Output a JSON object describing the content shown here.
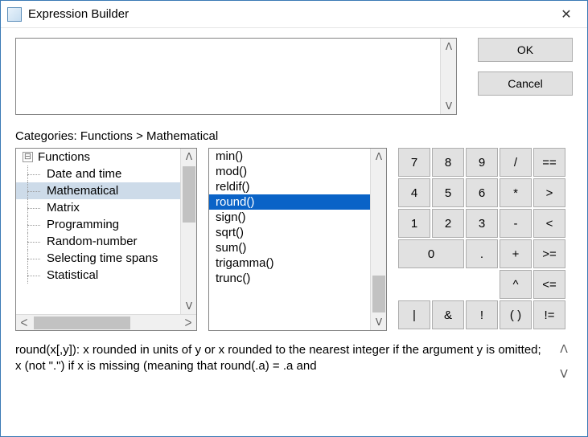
{
  "window": {
    "title": "Expression Builder",
    "close_glyph": "✕"
  },
  "expression": {
    "value": ""
  },
  "buttons": {
    "ok": "OK",
    "cancel": "Cancel"
  },
  "breadcrumb": "Categories: Functions > Mathematical",
  "tree": {
    "root": "Functions",
    "items": [
      "Date and time",
      "Mathematical",
      "Matrix",
      "Programming",
      "Random-number",
      "Selecting time spans",
      "Statistical"
    ],
    "selected_index": 1
  },
  "functions": {
    "items": [
      "min()",
      "mod()",
      "reldif()",
      "round()",
      "sign()",
      "sqrt()",
      "sum()",
      "trigamma()",
      "trunc()"
    ],
    "selected_index": 3
  },
  "keypad": {
    "rows": [
      [
        "7",
        "8",
        "9",
        "/",
        "=="
      ],
      [
        "4",
        "5",
        "6",
        "*",
        ">"
      ],
      [
        "1",
        "2",
        "3",
        "-",
        "<"
      ],
      [
        "0",
        "0",
        ".",
        "+",
        ">="
      ],
      [
        "|",
        "&",
        "!",
        "^",
        "<="
      ],
      [
        "",
        "",
        "",
        "( )",
        "!="
      ]
    ],
    "row3_zero_wide": true,
    "row5_shift": [
      "|",
      "&",
      "!",
      "( )",
      "!="
    ]
  },
  "description": "round(x[,y]):  x rounded in units of y or x rounded to the nearest integer if the argument y is omitted; x (not \".\") if x is missing (meaning that round(.a) = .a and",
  "glyphs": {
    "up": "ᐱ",
    "down": "ᐯ",
    "left": "ᐸ",
    "right": "ᐳ"
  }
}
